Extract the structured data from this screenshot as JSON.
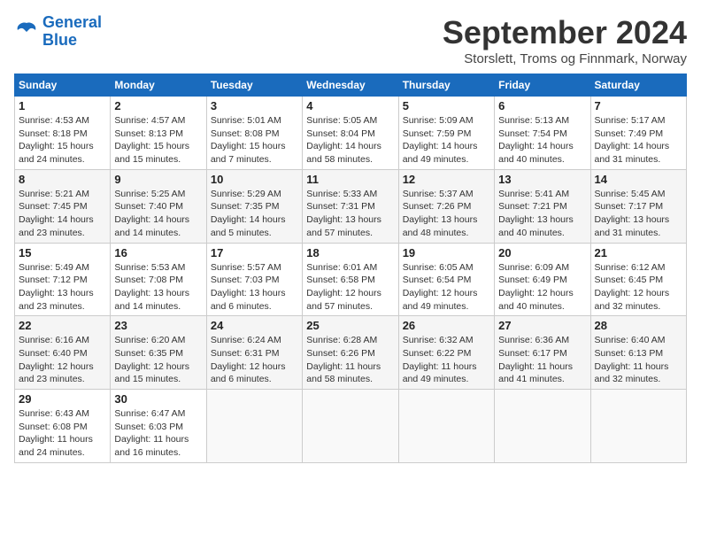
{
  "logo": {
    "text_general": "General",
    "text_blue": "Blue"
  },
  "header": {
    "title": "September 2024",
    "subtitle": "Storslett, Troms og Finnmark, Norway"
  },
  "columns": [
    "Sunday",
    "Monday",
    "Tuesday",
    "Wednesday",
    "Thursday",
    "Friday",
    "Saturday"
  ],
  "weeks": [
    [
      {
        "day": "1",
        "info": "Sunrise: 4:53 AM\nSunset: 8:18 PM\nDaylight: 15 hours\nand 24 minutes."
      },
      {
        "day": "2",
        "info": "Sunrise: 4:57 AM\nSunset: 8:13 PM\nDaylight: 15 hours\nand 15 minutes."
      },
      {
        "day": "3",
        "info": "Sunrise: 5:01 AM\nSunset: 8:08 PM\nDaylight: 15 hours\nand 7 minutes."
      },
      {
        "day": "4",
        "info": "Sunrise: 5:05 AM\nSunset: 8:04 PM\nDaylight: 14 hours\nand 58 minutes."
      },
      {
        "day": "5",
        "info": "Sunrise: 5:09 AM\nSunset: 7:59 PM\nDaylight: 14 hours\nand 49 minutes."
      },
      {
        "day": "6",
        "info": "Sunrise: 5:13 AM\nSunset: 7:54 PM\nDaylight: 14 hours\nand 40 minutes."
      },
      {
        "day": "7",
        "info": "Sunrise: 5:17 AM\nSunset: 7:49 PM\nDaylight: 14 hours\nand 31 minutes."
      }
    ],
    [
      {
        "day": "8",
        "info": "Sunrise: 5:21 AM\nSunset: 7:45 PM\nDaylight: 14 hours\nand 23 minutes."
      },
      {
        "day": "9",
        "info": "Sunrise: 5:25 AM\nSunset: 7:40 PM\nDaylight: 14 hours\nand 14 minutes."
      },
      {
        "day": "10",
        "info": "Sunrise: 5:29 AM\nSunset: 7:35 PM\nDaylight: 14 hours\nand 5 minutes."
      },
      {
        "day": "11",
        "info": "Sunrise: 5:33 AM\nSunset: 7:31 PM\nDaylight: 13 hours\nand 57 minutes."
      },
      {
        "day": "12",
        "info": "Sunrise: 5:37 AM\nSunset: 7:26 PM\nDaylight: 13 hours\nand 48 minutes."
      },
      {
        "day": "13",
        "info": "Sunrise: 5:41 AM\nSunset: 7:21 PM\nDaylight: 13 hours\nand 40 minutes."
      },
      {
        "day": "14",
        "info": "Sunrise: 5:45 AM\nSunset: 7:17 PM\nDaylight: 13 hours\nand 31 minutes."
      }
    ],
    [
      {
        "day": "15",
        "info": "Sunrise: 5:49 AM\nSunset: 7:12 PM\nDaylight: 13 hours\nand 23 minutes."
      },
      {
        "day": "16",
        "info": "Sunrise: 5:53 AM\nSunset: 7:08 PM\nDaylight: 13 hours\nand 14 minutes."
      },
      {
        "day": "17",
        "info": "Sunrise: 5:57 AM\nSunset: 7:03 PM\nDaylight: 13 hours\nand 6 minutes."
      },
      {
        "day": "18",
        "info": "Sunrise: 6:01 AM\nSunset: 6:58 PM\nDaylight: 12 hours\nand 57 minutes."
      },
      {
        "day": "19",
        "info": "Sunrise: 6:05 AM\nSunset: 6:54 PM\nDaylight: 12 hours\nand 49 minutes."
      },
      {
        "day": "20",
        "info": "Sunrise: 6:09 AM\nSunset: 6:49 PM\nDaylight: 12 hours\nand 40 minutes."
      },
      {
        "day": "21",
        "info": "Sunrise: 6:12 AM\nSunset: 6:45 PM\nDaylight: 12 hours\nand 32 minutes."
      }
    ],
    [
      {
        "day": "22",
        "info": "Sunrise: 6:16 AM\nSunset: 6:40 PM\nDaylight: 12 hours\nand 23 minutes."
      },
      {
        "day": "23",
        "info": "Sunrise: 6:20 AM\nSunset: 6:35 PM\nDaylight: 12 hours\nand 15 minutes."
      },
      {
        "day": "24",
        "info": "Sunrise: 6:24 AM\nSunset: 6:31 PM\nDaylight: 12 hours\nand 6 minutes."
      },
      {
        "day": "25",
        "info": "Sunrise: 6:28 AM\nSunset: 6:26 PM\nDaylight: 11 hours\nand 58 minutes."
      },
      {
        "day": "26",
        "info": "Sunrise: 6:32 AM\nSunset: 6:22 PM\nDaylight: 11 hours\nand 49 minutes."
      },
      {
        "day": "27",
        "info": "Sunrise: 6:36 AM\nSunset: 6:17 PM\nDaylight: 11 hours\nand 41 minutes."
      },
      {
        "day": "28",
        "info": "Sunrise: 6:40 AM\nSunset: 6:13 PM\nDaylight: 11 hours\nand 32 minutes."
      }
    ],
    [
      {
        "day": "29",
        "info": "Sunrise: 6:43 AM\nSunset: 6:08 PM\nDaylight: 11 hours\nand 24 minutes."
      },
      {
        "day": "30",
        "info": "Sunrise: 6:47 AM\nSunset: 6:03 PM\nDaylight: 11 hours\nand 16 minutes."
      },
      {
        "day": "",
        "info": ""
      },
      {
        "day": "",
        "info": ""
      },
      {
        "day": "",
        "info": ""
      },
      {
        "day": "",
        "info": ""
      },
      {
        "day": "",
        "info": ""
      }
    ]
  ]
}
